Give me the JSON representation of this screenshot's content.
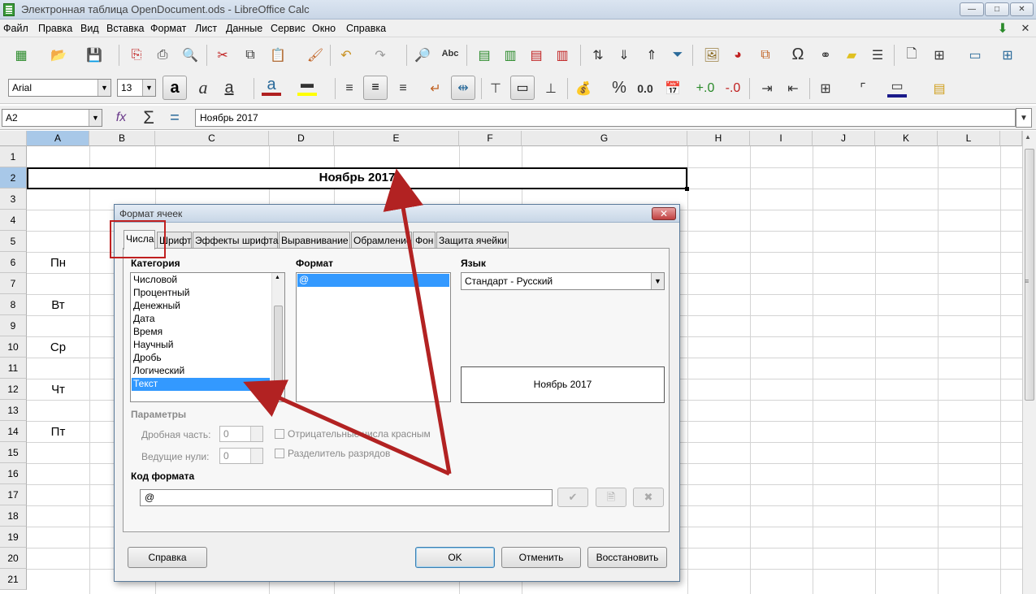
{
  "window": {
    "title": "Электронная таблица OpenDocument.ods - LibreOffice Calc",
    "min": "—",
    "max": "□",
    "close": "✕"
  },
  "menu": [
    "Файл",
    "Правка",
    "Вид",
    "Вставка",
    "Формат",
    "Лист",
    "Данные",
    "Сервис",
    "Окно",
    "Справка"
  ],
  "toolbar": {
    "font_name": "Arial",
    "font_size": "13",
    "bold": "a",
    "italic": "a",
    "underline": "a",
    "percent": "%",
    "number": "0.0",
    "abc": "Abc"
  },
  "formula_bar": {
    "cell_ref": "A2",
    "content": "Ноябрь 2017"
  },
  "sheet": {
    "columns": [
      "A",
      "B",
      "C",
      "D",
      "E",
      "F",
      "G",
      "H",
      "I",
      "J",
      "K",
      "L"
    ],
    "rows": [
      "1",
      "2",
      "3",
      "4",
      "5",
      "6",
      "7",
      "8",
      "9",
      "10",
      "11",
      "12",
      "13",
      "14",
      "15",
      "16",
      "17",
      "18",
      "19",
      "20",
      "21"
    ],
    "merged_title": "Ноябрь 2017",
    "weekday_pn": "Пн",
    "weekday_vt": "Вт",
    "weekday_sr": "Ср",
    "weekday_cht": "Чт",
    "weekday_pt": "Пт"
  },
  "dialog": {
    "title": "Формат ячеек",
    "tabs": [
      "Числа",
      "Шрифт",
      "Эффекты шрифта",
      "Выравнивание",
      "Обрамление",
      "Фон",
      "Защита ячейки"
    ],
    "category_label": "Категория",
    "categories": [
      "Числовой",
      "Процентный",
      "Денежный",
      "Дата",
      "Время",
      "Научный",
      "Дробь",
      "Логический",
      "Текст"
    ],
    "selected_category": "Текст",
    "format_label": "Формат",
    "format_items": [
      "@"
    ],
    "language_label": "Язык",
    "language_value": "Стандарт - Русский",
    "preview": "Ноябрь 2017",
    "params_label": "Параметры",
    "decimals_label": "Дробная часть:",
    "decimals_value": "0",
    "leading_zeros_label": "Ведущие нули:",
    "leading_zeros_value": "0",
    "negative_red_label": "Отрицательные числа красным",
    "thousands_sep_label": "Разделитель разрядов",
    "format_code_label": "Код формата",
    "format_code_value": "@",
    "help_button": "Справка",
    "ok_button": "OK",
    "cancel_button": "Отменить",
    "reset_button": "Восстановить"
  },
  "annotation_color": "#b22222"
}
